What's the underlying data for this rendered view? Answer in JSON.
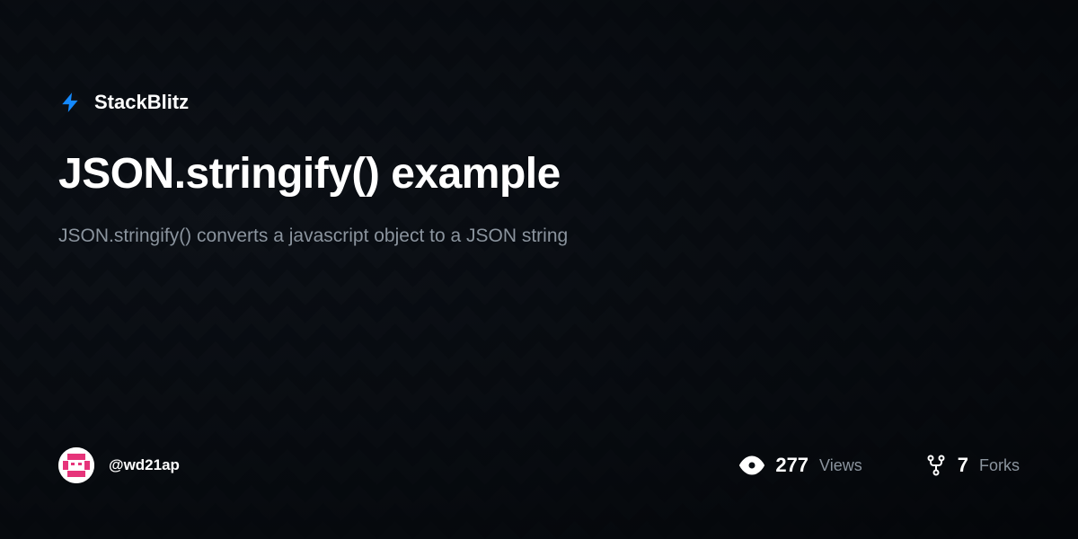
{
  "brand": {
    "name": "StackBlitz"
  },
  "project": {
    "title": "JSON.stringify() example",
    "description": "JSON.stringify() converts a javascript object to a JSON string"
  },
  "author": {
    "username": "@wd21ap"
  },
  "stats": {
    "views": {
      "value": "277",
      "label": "Views"
    },
    "forks": {
      "value": "7",
      "label": "Forks"
    }
  },
  "colors": {
    "accent": "#1489fd",
    "text_muted": "#8b949e"
  }
}
